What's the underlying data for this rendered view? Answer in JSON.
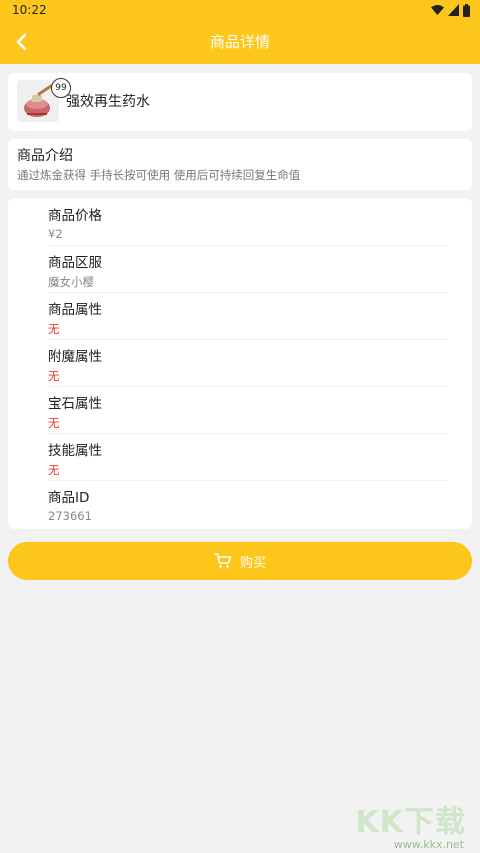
{
  "status_bar": {
    "time": "10:22"
  },
  "header": {
    "title": "商品详情"
  },
  "product": {
    "badge": "99",
    "name": "强效再生药水"
  },
  "intro": {
    "title": "商品介绍",
    "description": "通过炼金获得 手持长按可使用 使用后可持续回复生命值"
  },
  "attributes": [
    {
      "label": "商品价格",
      "value": "¥2"
    },
    {
      "label": "商品区服",
      "value": "魔女小樱"
    },
    {
      "label": "商品属性",
      "value": "无"
    },
    {
      "label": "附魔属性",
      "value": "无"
    },
    {
      "label": "宝石属性",
      "value": "无"
    },
    {
      "label": "技能属性",
      "value": "无"
    },
    {
      "label": "商品ID",
      "value": "273661"
    }
  ],
  "buy_button": {
    "label": "购买"
  },
  "watermark": {
    "logo": "KK下载",
    "url": "www.kkx.net"
  },
  "colors": {
    "accent": "#fdc61b",
    "highlight": "#e53935"
  }
}
